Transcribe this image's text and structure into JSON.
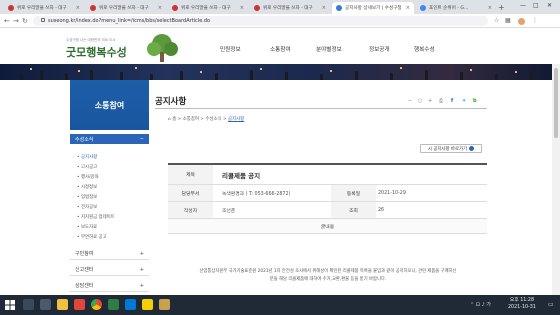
{
  "browser": {
    "tabs": [
      {
        "label": "위로 우리말을 쓰자 - 대구"
      },
      {
        "label": "위로 우리말을 쓰자 - 대구"
      },
      {
        "label": "위로 우리말을 쓰자 - 대구"
      },
      {
        "label": "위로 우리말을 쓰자 - 대구"
      },
      {
        "label": "공지사항 상세보기 | 수성구청"
      },
      {
        "label": "포인트 순위어 - G…"
      }
    ],
    "url": "suseong.kr/index.do?menu_link=/icms/bbs/selectBoardArticle.do"
  },
  "site": {
    "logo_sub": "수성구청 나는 대한민국 미소 도시",
    "logo_text": "굿모행복수성",
    "gnb": [
      "민원정보",
      "소통참여",
      "분야별정보",
      "정보공개",
      "행복수성"
    ]
  },
  "sidebar": {
    "title": "소통참여",
    "section": "수성소식",
    "section_icon": "minus-icon",
    "subs": [
      "공지사항",
      "고시공고",
      "행사/강좌",
      "시정정보",
      "입법정보",
      "전자공보",
      "지지원금 업데이트",
      "보도자료",
      "무면허료 공고"
    ],
    "items": [
      {
        "label": "구민참여"
      },
      {
        "label": "신고센터"
      },
      {
        "label": "상담센터"
      }
    ]
  },
  "page": {
    "title": "공지사항",
    "breadcrumb": [
      "홈",
      "소통참여",
      "수성소식",
      "공지사항"
    ],
    "download_button": "시 공지사항 바로가기"
  },
  "article": {
    "labels": {
      "subject": "제목",
      "dept": "담당부서",
      "date": "등록일",
      "author": "작성자",
      "views": "조회",
      "content": "글내용"
    },
    "subject": "리콜제품 공지",
    "dept": "녹색환경과 ( T: 053-666-2872)",
    "date": "2021-10-29",
    "author": "조선준",
    "views": "26",
    "body_line1": "산업통상자원부 국가기술표준원 2021년 1차 안전성 조사에서 위해성이 확인된 리콜제품 목록을 붙임과 같이 공지하오니, 관련 제품을 구매하신",
    "body_line2": "분들 해당 리콜제품에 대하여 수거,교환,환불 등을 받기 바랍니다."
  },
  "taskbar": {
    "time": "오후 11:28",
    "date": "2021-10-31"
  }
}
